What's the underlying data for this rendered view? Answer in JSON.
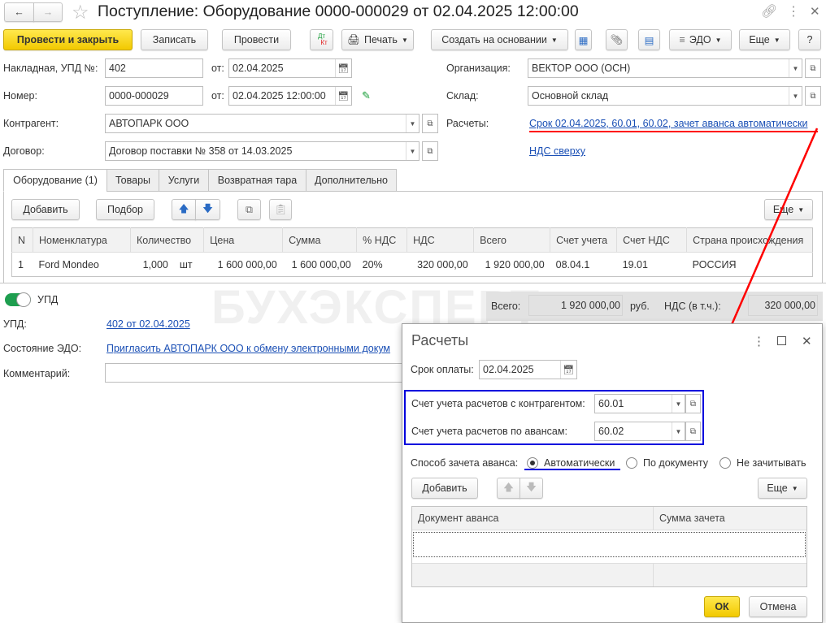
{
  "title": "Поступление: Оборудование 0000-000029 от 02.04.2025 12:00:00",
  "toolbar": {
    "post_close": "Провести и закрыть",
    "save": "Записать",
    "post": "Провести",
    "dtkt_dt": "Дт",
    "dtkt_kt": "Кт",
    "print": "Печать",
    "create_based": "Создать на основании",
    "edo": "ЭДО",
    "more": "Еще",
    "help": "?"
  },
  "header": {
    "invoice_label": "Накладная, УПД №:",
    "invoice_value": "402",
    "from_label": "от:",
    "invoice_date": "02.04.2025",
    "number_label": "Номер:",
    "number_value": "0000-000029",
    "number_date": "02.04.2025 12:00:00",
    "org_label": "Организация:",
    "org_value": "ВЕКТОР ООО (ОСН)",
    "warehouse_label": "Склад:",
    "warehouse_value": "Основной склад",
    "counterparty_label": "Контрагент:",
    "counterparty_value": "АВТОПАРК ООО",
    "settlements_label": "Расчеты:",
    "settlements_link": "Срок 02.04.2025, 60.01, 60.02, зачет аванса автоматически",
    "contract_label": "Договор:",
    "contract_value": "Договор поставки № 358 от 14.03.2025",
    "vat_link": "НДС сверху"
  },
  "tabs": [
    "Оборудование (1)",
    "Товары",
    "Услуги",
    "Возвратная тара",
    "Дополнительно"
  ],
  "table_toolbar": {
    "add": "Добавить",
    "pick": "Подбор",
    "more": "Еще"
  },
  "table": {
    "columns": [
      "N",
      "Номенклатура",
      "Количество",
      "",
      "Цена",
      "Сумма",
      "% НДС",
      "НДС",
      "Всего",
      "Счет учета",
      "Счет НДС",
      "Страна происхождения"
    ],
    "rows": [
      [
        "1",
        "Ford Mondeo",
        "1,000",
        "шт",
        "1 600 000,00",
        "1 600 000,00",
        "20%",
        "320 000,00",
        "1 920 000,00",
        "08.04.1",
        "19.01",
        "РОССИЯ"
      ]
    ]
  },
  "totals": {
    "total_label": "Всего:",
    "total_value": "1 920 000,00",
    "currency": "руб.",
    "vat_label": "НДС (в т.ч.):",
    "vat_value": "320 000,00"
  },
  "footer": {
    "upd_toggle": "УПД",
    "upd_toggle_on": true,
    "upd_label": "УПД:",
    "upd_link": "402 от 02.04.2025",
    "edo_label": "Состояние ЭДО:",
    "edo_link": "Пригласить АВТОПАРК ООО к обмену электронными докум",
    "comment_label": "Комментарий:",
    "comment_value": ""
  },
  "watermark": "БУХЭКСПЕРТ",
  "dialog": {
    "title": "Расчеты",
    "due_label": "Срок оплаты:",
    "due_value": "02.04.2025",
    "acct_cp_label": "Счет учета расчетов с контрагентом:",
    "acct_cp_value": "60.01",
    "acct_adv_label": "Счет учета расчетов по авансам:",
    "acct_adv_value": "60.02",
    "method_label": "Способ зачета аванса:",
    "methods": [
      "Автоматически",
      "По документу",
      "Не зачитывать"
    ],
    "method_selected": "Автоматически",
    "add": "Добавить",
    "more": "Еще",
    "columns": [
      "Документ аванса",
      "Сумма зачета"
    ],
    "ok": "ОК",
    "cancel": "Отмена"
  },
  "colors": {
    "accent_yellow": "#f5d20a",
    "link": "#1a4fb5",
    "annotation_red": "#ff0000",
    "annotation_blue": "#0000dd",
    "toggle_green": "#1e9e4f"
  }
}
